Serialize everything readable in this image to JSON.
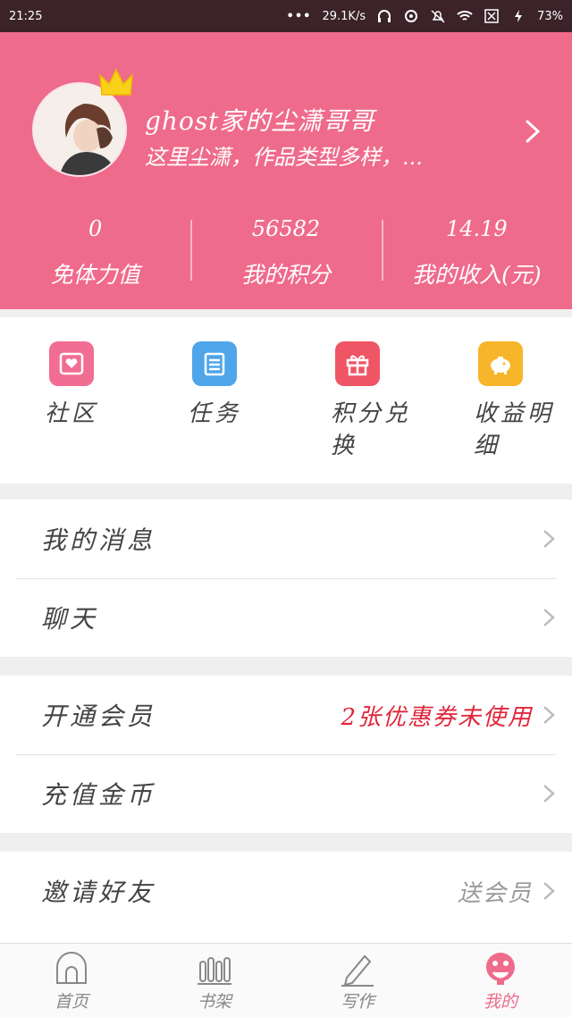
{
  "status_bar": {
    "time": "21:25",
    "network_speed": "29.1K/s",
    "battery": "73%"
  },
  "profile": {
    "username": "ghost家的尘潇哥哥",
    "bio": "这里尘潇，作品类型多样，...",
    "stats": [
      {
        "value": "0",
        "label": "免体力值"
      },
      {
        "value": "56582",
        "label": "我的积分"
      },
      {
        "value": "14.19",
        "label": "我的收入(元)"
      }
    ]
  },
  "quick_actions": [
    {
      "label": "社区",
      "color": "#f26d92",
      "icon": "community-icon"
    },
    {
      "label": "任务",
      "color": "#4fa5ea",
      "icon": "task-icon"
    },
    {
      "label": "积分兑换",
      "color": "#ef5565",
      "icon": "gift-icon"
    },
    {
      "label": "收益明细",
      "color": "#f7b52a",
      "icon": "piggy-bank-icon"
    }
  ],
  "menu": {
    "messages": "我的消息",
    "chat": "聊天",
    "vip": "开通会员",
    "vip_note": "2张优惠券未使用",
    "recharge": "充值金币",
    "invite": "邀请好友",
    "invite_note": "送会员"
  },
  "bottom_nav": [
    {
      "label": "首页",
      "icon": "home-icon"
    },
    {
      "label": "书架",
      "icon": "bookshelf-icon"
    },
    {
      "label": "写作",
      "icon": "pencil-icon"
    },
    {
      "label": "我的",
      "icon": "profile-icon"
    }
  ],
  "colors": {
    "brand_pink": "#ef6b8b",
    "status_bar": "#3b2329",
    "accent_red": "#e0253b"
  }
}
